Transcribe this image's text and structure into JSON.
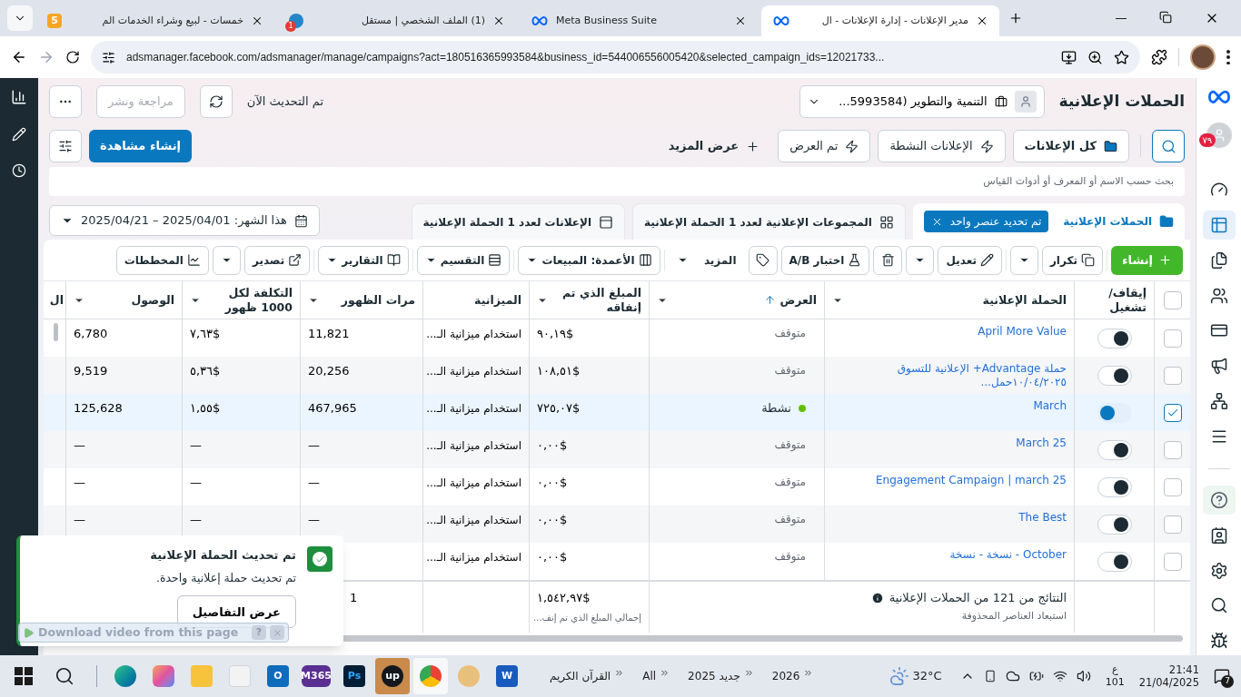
{
  "browser": {
    "tabs": [
      {
        "title": "مدير الإعلانات - إدارة الإعلانات - ال",
        "kind": "meta",
        "selected": true
      },
      {
        "title": "Meta Business Suite",
        "kind": "meta",
        "selected": false
      },
      {
        "title": "(1) الملف الشخصي | مستقل",
        "kind": "mostaql",
        "badge": "1",
        "selected": false
      },
      {
        "title": "خمسات - لبيع وشراء الخدمات الم",
        "kind": "khamsat",
        "badge": "5",
        "selected": false
      }
    ],
    "url": "adsmanager.facebook.com/adsmanager/manage/campaigns?act=180516365993584&business_id=544006556005420&selected_campaign_ids=12021733..."
  },
  "header": {
    "title": "الحملات الإعلانية",
    "account": "التنمية والتطوير (5993584...",
    "updated": "تم التحديث الآن",
    "review_button": {
      "label": "مراجعة ونشر",
      "disabled": true
    }
  },
  "filters": [
    {
      "label": "كل الإعلانات",
      "kind": "folder",
      "selected": true
    },
    {
      "label": "الإعلانات النشطة",
      "kind": "bolt",
      "selected": false
    },
    {
      "label": "تم العرض",
      "kind": "bolt",
      "selected": false
    }
  ],
  "show_more": "عرض المزيد",
  "create_view": "إنشاء مشاهدة",
  "search": {
    "placeholder": "بحث حسب الاسم أو المعرف أو أدوات القياس"
  },
  "level_tabs": [
    {
      "label": "الحملات الإعلانية",
      "kind": "folder",
      "selected": true,
      "chip": "تم تحديد عنصر واحد"
    },
    {
      "label": "المجموعات الإعلانية لعدد 1 الحملة الإعلانية",
      "kind": "grid",
      "selected": false
    },
    {
      "label": "الإعلانات لعدد 1 الحملة الإعلانية",
      "kind": "window",
      "selected": false
    }
  ],
  "date_range": "هذا الشهر: 2025/04/01 – 2025/04/21",
  "toolbar": [
    {
      "kind": "primary",
      "label": "إنشاء"
    },
    {
      "kind": "split",
      "label": "تكرار"
    },
    {
      "kind": "split",
      "label": "تعديل"
    },
    {
      "kind": "icon"
    },
    {
      "kind": "button",
      "label": "اختبار A/B"
    },
    {
      "kind": "icon"
    },
    {
      "kind": "menu",
      "label": "المزيد"
    },
    {
      "kind": "dropdown",
      "label": "الأعمدة: المبيعات"
    },
    {
      "kind": "dropdown",
      "label": "التقسيم"
    },
    {
      "kind": "dropdown",
      "label": "التقارير"
    },
    {
      "kind": "split",
      "label": "تصدير"
    },
    {
      "kind": "button",
      "label": "المخططات"
    }
  ],
  "table": {
    "select_all": {
      "checked": false
    },
    "columns": [
      {
        "label": "إيقاف/ تشغيل",
        "menu": false,
        "sorted": false
      },
      {
        "label": "الحملة الإعلانية",
        "menu": true,
        "sorted": false
      },
      {
        "label": "العرض",
        "menu": true,
        "sorted": true
      },
      {
        "label": "المبلغ الذي تم إنفاقه",
        "menu": true,
        "sorted": false
      },
      {
        "label": "الميزانية",
        "menu": false,
        "sorted": false
      },
      {
        "label": "مرات الظهور",
        "menu": true,
        "sorted": false
      },
      {
        "label": "التكلفة لكل 1000 ظهور",
        "menu": true,
        "sorted": false
      },
      {
        "label": "الوصول",
        "menu": true,
        "sorted": false
      },
      {
        "label": "ال"
      }
    ],
    "rows": [
      {
        "name": "April More Value",
        "on": false,
        "selected": false,
        "delivery": "متوقف",
        "kind": "paused",
        "spent": "٩٠,١٩$",
        "budget": "استخدام ميزانية الـ...",
        "impressions": "11,821",
        "cpm": "٧,٦٣$",
        "reach": "6,780"
      },
      {
        "name": "حملة Advantage+ الإعلانية للتسوق ١٠/٠٤/٢٠٢٥حمل...",
        "on": false,
        "selected": false,
        "delivery": "متوقف",
        "kind": "paused",
        "spent": "١٠٨,٥١$",
        "budget": "استخدام ميزانية الـ...",
        "impressions": "20,256",
        "cpm": "٥,٣٦$",
        "reach": "9,519"
      },
      {
        "name": "March",
        "on": true,
        "selected": true,
        "delivery": "نشطة",
        "kind": "active",
        "spent": "٧٢٥,٠٧$",
        "budget": "استخدام ميزانية الـ...",
        "impressions": "467,965",
        "cpm": "١,٥٥$",
        "reach": "125,628"
      },
      {
        "name": "March 25",
        "on": false,
        "selected": false,
        "delivery": "متوقف",
        "kind": "paused",
        "spent": "٠,٠٠$",
        "budget": "استخدام ميزانية الـ...",
        "impressions": "—",
        "cpm": "—",
        "reach": "—"
      },
      {
        "name": "Engagement Campaign | march 25",
        "on": false,
        "selected": false,
        "delivery": "متوقف",
        "kind": "paused",
        "spent": "٠,٠٠$",
        "budget": "استخدام ميزانية الـ...",
        "impressions": "—",
        "cpm": "—",
        "reach": "—"
      },
      {
        "name": "The Best",
        "on": false,
        "selected": false,
        "delivery": "متوقف",
        "kind": "paused",
        "spent": "٠,٠٠$",
        "budget": "استخدام ميزانية الـ...",
        "impressions": "—",
        "cpm": "—",
        "reach": "—"
      },
      {
        "name": "October - نسخة - نسخة",
        "on": false,
        "selected": false,
        "delivery": "متوقف",
        "kind": "paused",
        "spent": "٠,٠٠$",
        "budget": "استخدام ميزانية الـ..."
      }
    ],
    "footer": {
      "results": "النتائج من 121 من الحملات الإعلانية",
      "note": "استبعاد العناصر المحذوفة",
      "spent": "١,٥٤٢,٩٧$",
      "spent_note": "إجمالي المبلغ الذي تم إنف...",
      "impressions": "1"
    }
  },
  "toast": {
    "title": "تم تحديث الحملة الإعلانية",
    "body": "تم تحديث حملة إعلانية واحدة.",
    "button": "عرض التفاصيل"
  },
  "download_bar": {
    "label": "Download video from this page",
    "help": "?"
  },
  "right_rail": {
    "badge": "٧٩",
    "items": [
      {
        "selected": false
      },
      {
        "selected": true
      },
      {
        "selected": false
      },
      {
        "selected": false
      },
      {
        "selected": false
      },
      {
        "selected": false
      },
      {
        "selected": false
      },
      {
        "selected": false
      },
      {
        "selected": false
      },
      {
        "selected": false
      },
      {
        "selected": false
      },
      {
        "selected": false
      },
      {
        "selected": false
      }
    ]
  },
  "taskbar": {
    "apps": [
      {
        "kind": "word",
        "label": "W",
        "selected": false
      },
      {
        "kind": "paint",
        "selected": false
      },
      {
        "kind": "chrome",
        "selected": true
      },
      {
        "kind": "upwork",
        "label": "up",
        "selected": false
      },
      {
        "kind": "photoshop",
        "label": "Ps",
        "selected": false
      },
      {
        "kind": "m365",
        "label": "M365",
        "selected": false
      },
      {
        "kind": "outlook",
        "label": "O",
        "selected": false
      },
      {
        "kind": "store",
        "selected": false
      },
      {
        "kind": "explorer",
        "selected": false
      },
      {
        "kind": "copilot",
        "selected": false
      },
      {
        "kind": "edge",
        "selected": false
      }
    ],
    "folders": [
      "2026",
      "جديد 2025",
      "All",
      "القرآن الكريم"
    ],
    "weather": "32°C",
    "lang": "ع",
    "lang_sub": "101",
    "time": "21:41",
    "date": "21/04/2025",
    "notifications": "7"
  }
}
